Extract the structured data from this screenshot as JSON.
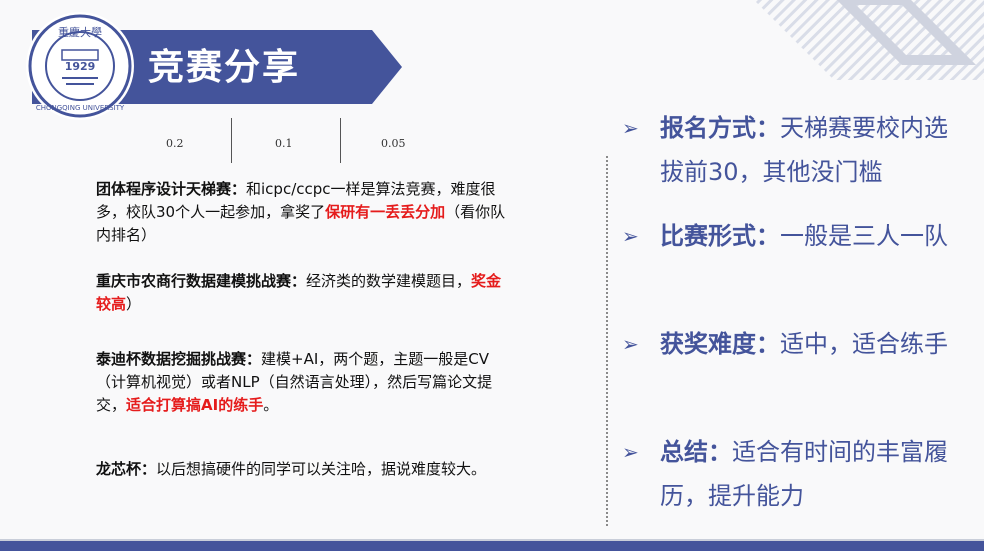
{
  "header": {
    "title": "竞赛分享",
    "logo_name": "Chongqing University seal",
    "logo_year": "1929",
    "logo_text": "CHONGQING UNIVERSITY",
    "logo_chinese": "重慶大學"
  },
  "table": {
    "cells": [
      "0.2",
      "0.1",
      "0.05"
    ]
  },
  "left": {
    "blocks": [
      {
        "head": "团体程序设计天梯赛：",
        "text1": "和icpc/ccpc一样是算法竞赛，难度很多，校队30个人一起参加，拿奖了",
        "highlight": "保研有一丢丢分加",
        "text2": "（看你队内排名）"
      },
      {
        "head": "重庆市农商行数据建模挑战赛：",
        "text1": "经济类的数学建模题目，",
        "highlight": "奖金较高",
        "text2": "）"
      },
      {
        "head": "泰迪杯数据挖掘挑战赛：",
        "text1": "建模+AI，两个题，主题一般是CV（计算机视觉）或者NLP（自然语言处理），然后写篇论文提交，",
        "highlight": "适合打算搞AI的练手",
        "text2": "。"
      },
      {
        "head": "龙芯杯：",
        "text1": "以后想搞硬件的同学可以关注哈，据说难度较大。",
        "highlight": "",
        "text2": ""
      }
    ]
  },
  "right": {
    "bullets": [
      {
        "head": "报名方式：",
        "text": "天梯赛要校内选拔前30，其他没门槛"
      },
      {
        "head": "比赛形式：",
        "text": "一般是三人一队"
      },
      {
        "head": "获奖难度：",
        "text": "适中，适合练手"
      },
      {
        "head": "总结：",
        "text": "适合有时间的丰富履历，提升能力"
      }
    ]
  },
  "colors": {
    "brand": "#44549b",
    "highlight": "#e51c1c"
  }
}
